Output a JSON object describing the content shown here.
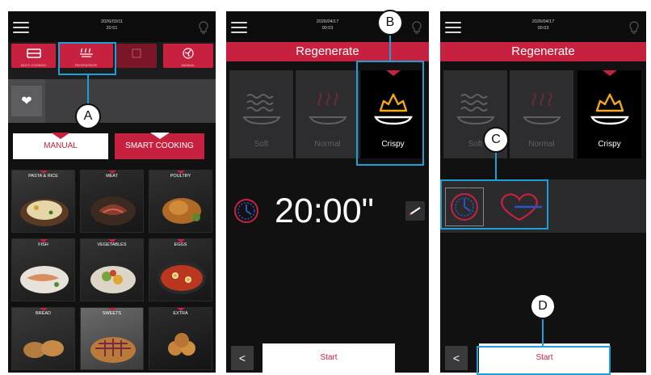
{
  "colors": {
    "accent": "#c8213f",
    "callout": "#1e9fd6",
    "panel_bg": "#111112",
    "selected_icon": "#f6a81c",
    "probe_icon": "#c8213f"
  },
  "screen1": {
    "datetime": [
      "2026/03/11",
      "20:51"
    ],
    "tabs": [
      "MULTI COOKING",
      "REGENERATE",
      "",
      "MANUAL"
    ],
    "favorites_icon": "heart-icon",
    "mode_buttons": {
      "manual": "MANUAL",
      "smart": "SMART COOKING"
    },
    "categories": [
      "PASTA & RICE",
      "MEAT",
      "POULTRY",
      "FISH",
      "VEGETABLES",
      "EGGS",
      "BREAD",
      "SWEETS",
      "EXTRA"
    ]
  },
  "screen2": {
    "datetime": [
      "2026/04/17",
      "00:03"
    ],
    "title": "Regenerate",
    "options": [
      "Soft",
      "Normal",
      "Crispy"
    ],
    "selected": "Crispy",
    "timer": "20:00\"",
    "back_icon": "<",
    "start": "Start"
  },
  "screen3": {
    "datetime": [
      "2026/04/17",
      "00:03"
    ],
    "title": "Regenerate",
    "options": [
      "Soft",
      "Normal",
      "Crispy"
    ],
    "selected": "Crispy",
    "back_icon": "<",
    "start": "Start",
    "icons": [
      "clock-icon",
      "probe-heart-icon"
    ]
  },
  "callouts": {
    "a": "A",
    "b": "B",
    "c": "C",
    "d": "D"
  }
}
